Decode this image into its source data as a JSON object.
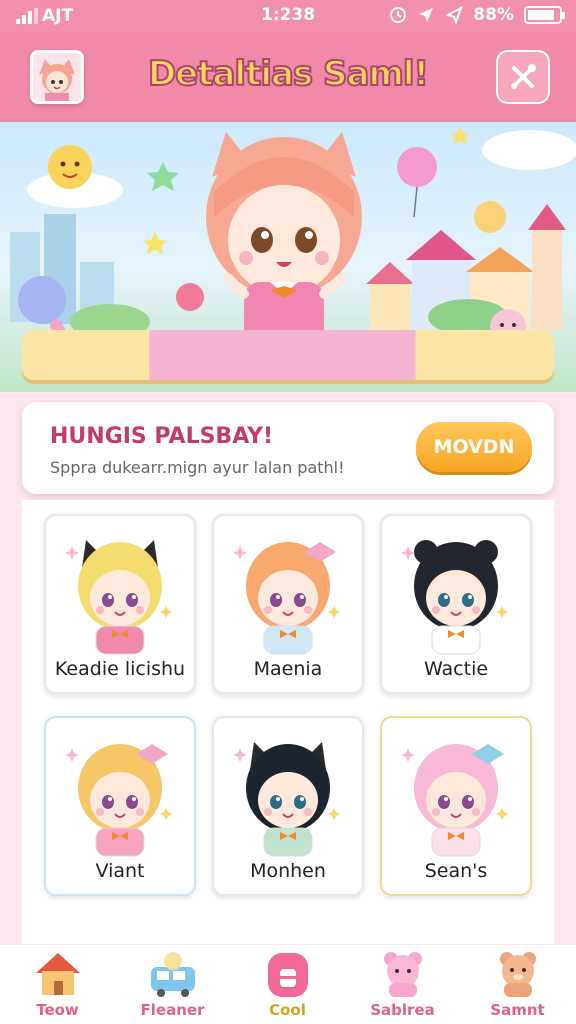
{
  "status": {
    "signal": "AJT",
    "time": "1:238",
    "battery": "88%",
    "battery_level": 0.88
  },
  "header": {
    "title": "Detaltias Saml!"
  },
  "banner": {
    "title": "HUNGIS PALSBAY!",
    "subtitle": "Sppra dukearr.mign ayur lalan pathl!",
    "button": "MOVDN"
  },
  "characters": [
    {
      "name": "Keadie licishu",
      "hair": "#f4dc6e",
      "outfit": "#f28ab0",
      "ears": "cat-black"
    },
    {
      "name": "Maenia",
      "hair": "#f6a86f",
      "outfit": "#cfe8f7",
      "ears": "bow"
    },
    {
      "name": "Wactie",
      "hair": "#23262f",
      "outfit": "#ffffff",
      "ears": "buns"
    },
    {
      "name": "Viant",
      "hair": "#f6c766",
      "outfit": "#f7a5c0",
      "ears": "bow-pink"
    },
    {
      "name": "Monhen",
      "hair": "#1e2330",
      "outfit": "#bfe3d0",
      "ears": "cat-black"
    },
    {
      "name": "Sean's",
      "hair": "#f7b9d6",
      "outfit": "#fde0ea",
      "ears": "bow-blue"
    }
  ],
  "tabs": [
    {
      "label": "Teow",
      "icon": "house-icon"
    },
    {
      "label": "Fleaner",
      "icon": "bus-icon"
    },
    {
      "label": "Cool",
      "icon": "bag-icon"
    },
    {
      "label": "Sablrea",
      "icon": "bear-icon"
    },
    {
      "label": "Samnt",
      "icon": "teddy-icon"
    }
  ],
  "colors": {
    "accent": "#f18aa8",
    "title": "#ffd45c",
    "button": "#f5a623"
  }
}
